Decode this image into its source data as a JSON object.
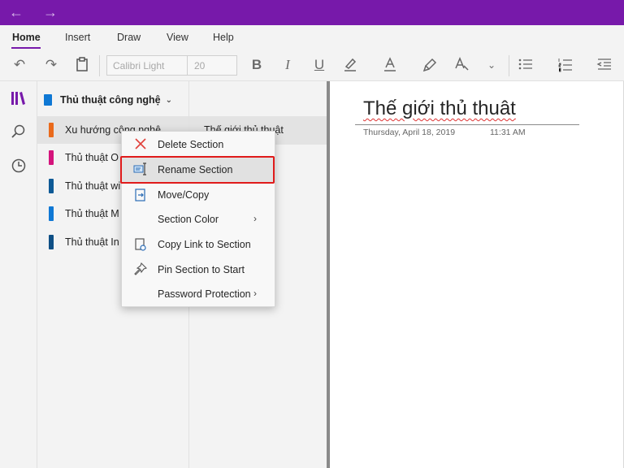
{
  "titlebar": {
    "back_icon": "arrow-left-icon",
    "forward_icon": "arrow-right-icon",
    "accent": "#7719aa"
  },
  "ribbon": {
    "tabs": [
      "Home",
      "Insert",
      "Draw",
      "View",
      "Help"
    ],
    "active_tab": "Home",
    "font_name": "Calibri Light",
    "font_size": "20"
  },
  "notebook": {
    "name": "Thủ thuật công nghệ",
    "sections": [
      {
        "label": "Xu hướng công nghệ",
        "color": "#ea6a1c"
      },
      {
        "label": "Thủ thuật O",
        "color": "#d4147c"
      },
      {
        "label": "Thủ thuật wi",
        "color": "#0e5a96"
      },
      {
        "label": "Thủ thuật M",
        "color": "#0f78d4"
      },
      {
        "label": "Thủ thuật In",
        "color": "#0e4f85"
      }
    ]
  },
  "pages": [
    {
      "label": "Thế giới thủ thuật"
    }
  ],
  "page": {
    "title": "Thế giới thủ thuât",
    "date": "Thursday, April 18, 2019",
    "time": "11:31 AM"
  },
  "context_menu": {
    "items": [
      {
        "label": "Delete Section",
        "icon": "delete-x-icon"
      },
      {
        "label": "Rename Section",
        "icon": "rename-icon"
      },
      {
        "label": "Move/Copy",
        "icon": "move-copy-icon"
      },
      {
        "label": "Section Color",
        "icon": "",
        "submenu": true
      },
      {
        "label": "Copy Link to Section",
        "icon": "copy-link-icon"
      },
      {
        "label": "Pin Section to Start",
        "icon": "pin-icon"
      },
      {
        "label": "Password Protection",
        "icon": "",
        "submenu": true
      }
    ],
    "highlighted": "Rename Section",
    "highlight_color": "#e01b1b"
  }
}
